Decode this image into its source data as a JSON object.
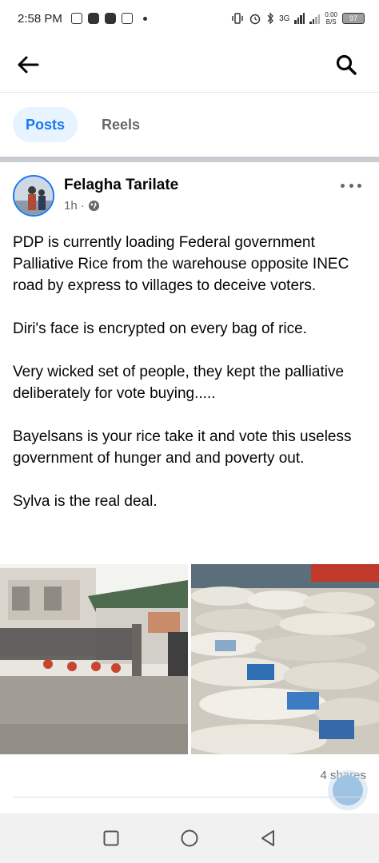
{
  "status_bar": {
    "time": "2:58 PM",
    "network": "3G",
    "speed_value": "0.00",
    "speed_unit": "B/S",
    "battery": "97"
  },
  "nav": {
    "back_icon": "arrow-left-icon",
    "search_icon": "search-icon"
  },
  "tabs": [
    {
      "label": "Posts",
      "active": true
    },
    {
      "label": "Reels",
      "active": false
    }
  ],
  "post": {
    "author": "Felagha Tarilate",
    "time": "1h",
    "separator": "·",
    "audience_icon": "globe-icon",
    "paragraphs": [
      "PDP is currently loading Federal government Palliative Rice from the warehouse opposite INEC road by express to villages to deceive voters.",
      "Diri's face is encrypted on every bag of rice.",
      "Very wicked set of people, they kept the palliative deliberately for vote buying.....",
      "Bayelsans is your rice take it and vote this useless government of hunger and and poverty out.",
      "Sylva is the real deal."
    ],
    "shares": "4 shares"
  },
  "colors": {
    "accent": "#1877f2",
    "tab_active_bg": "#e7f3ff",
    "secondary_text": "#65676b"
  }
}
